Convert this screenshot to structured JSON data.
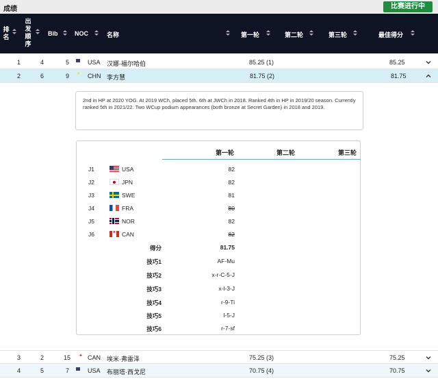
{
  "topbar": {
    "title": "成绩",
    "status_button": "比赛进行中"
  },
  "header": {
    "rank": [
      "排",
      "名"
    ],
    "order": [
      "出",
      "发",
      "顺",
      "序"
    ],
    "bib": "Bib",
    "noc": "NOC",
    "name": "名称",
    "run1": "第一轮",
    "run2": "第二轮",
    "run3": "第三轮",
    "best": "最佳得分"
  },
  "rows": [
    {
      "rank": "1",
      "order": "4",
      "bib": "5",
      "noc": "USA",
      "name": "汉娜·福尔哈伯",
      "run1": "85.25 (1)",
      "best": "85.25",
      "flag": "usa-flag-icon",
      "expanded": false
    },
    {
      "rank": "2",
      "order": "6",
      "bib": "9",
      "noc": "CHN",
      "name": "李方慧",
      "run1": "81.75 (2)",
      "best": "81.75",
      "flag": "china-flag-icon",
      "expanded": true
    },
    {
      "rank": "3",
      "order": "2",
      "bib": "15",
      "noc": "CAN",
      "name": "埃米·弗雷泽",
      "run1": "75.25 (3)",
      "best": "75.25",
      "flag": "canada-flag-icon",
      "expanded": false
    },
    {
      "rank": "4",
      "order": "5",
      "bib": "7",
      "noc": "USA",
      "name": "布丽塔·西戈尼",
      "run1": "70.75 (4)",
      "best": "70.75",
      "flag": "usa-flag-icon",
      "expanded": false
    }
  ],
  "bio": "2nd in HP at 2020 YOG. At 2019 WCh, placed 5th. 6th at JWCh in 2018. Ranked 4th in HP in 2019/20 season. Currently ranked 5th in 2021/22. Two WCup podium appearances (both bronze at Secret Garden) in 2018 and 2019.",
  "judges_panel": {
    "headers": {
      "run1": "第一轮",
      "run2": "第二轮",
      "run3": "第三轮"
    },
    "judges": [
      {
        "id": "J1",
        "noc": "USA",
        "score": "82",
        "dropped": false
      },
      {
        "id": "J2",
        "noc": "JPN",
        "score": "82",
        "dropped": false
      },
      {
        "id": "J3",
        "noc": "SWE",
        "score": "81",
        "dropped": false
      },
      {
        "id": "J4",
        "noc": "FRA",
        "score": "80",
        "dropped": true
      },
      {
        "id": "J5",
        "noc": "NOR",
        "score": "82",
        "dropped": false
      },
      {
        "id": "J6",
        "noc": "CAN",
        "score": "82",
        "dropped": true
      }
    ],
    "score_label": "得分",
    "score_value": "81.75",
    "tricks": [
      {
        "label": "技巧1",
        "value": "AF-Mu"
      },
      {
        "label": "技巧2",
        "value": "x-r-C-5-J"
      },
      {
        "label": "技巧3",
        "value": "x-l-3-J"
      },
      {
        "label": "技巧4",
        "value": "r-9-Ti"
      },
      {
        "label": "技巧5",
        "value": "l-5-J"
      },
      {
        "label": "技巧6",
        "value": "r-7-sf"
      }
    ]
  },
  "colors": {
    "header_bg": "#0e1424",
    "status_green": "#1e8e3e",
    "selected_row": "#d6eef6"
  }
}
